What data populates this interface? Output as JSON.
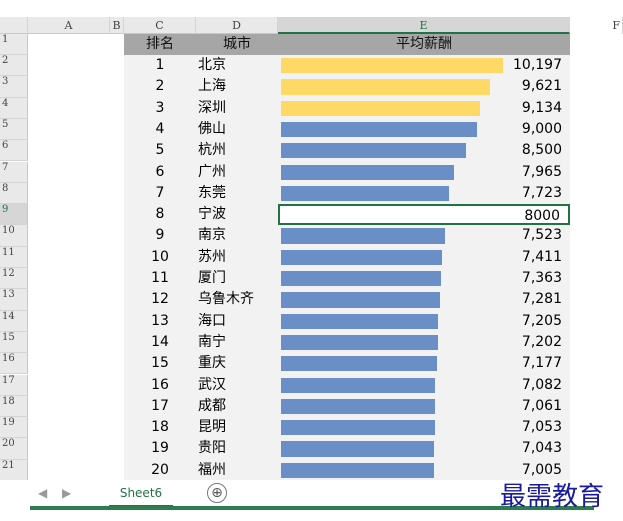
{
  "columns": [
    "A",
    "B",
    "C",
    "D",
    "E",
    "F"
  ],
  "headers": {
    "rank": "排名",
    "city": "城市",
    "salary": "平均薪酬"
  },
  "row_numbers": [
    "1",
    "2",
    "3",
    "4",
    "5",
    "6",
    "7",
    "8",
    "9",
    "10",
    "11",
    "12",
    "13",
    "14",
    "15",
    "16",
    "17",
    "18",
    "19",
    "20",
    "21"
  ],
  "rows": [
    {
      "rank": "1",
      "city": "北京",
      "value": "10,197",
      "amount": 10197,
      "color": "#ffd966"
    },
    {
      "rank": "2",
      "city": "上海",
      "value": "9,621",
      "amount": 9621,
      "color": "#ffd966"
    },
    {
      "rank": "3",
      "city": "深圳",
      "value": "9,134",
      "amount": 9134,
      "color": "#ffd966"
    },
    {
      "rank": "4",
      "city": "佛山",
      "value": "9,000",
      "amount": 9000,
      "color": "#6a8ec6"
    },
    {
      "rank": "5",
      "city": "杭州",
      "value": "8,500",
      "amount": 8500,
      "color": "#6a8ec6"
    },
    {
      "rank": "6",
      "city": "广州",
      "value": "7,965",
      "amount": 7965,
      "color": "#6a8ec6"
    },
    {
      "rank": "7",
      "city": "东莞",
      "value": "7,723",
      "amount": 7723,
      "color": "#6a8ec6"
    },
    {
      "rank": "8",
      "city": "宁波",
      "value": "8000",
      "amount": 0,
      "color": "#6a8ec6",
      "selected": true
    },
    {
      "rank": "9",
      "city": "南京",
      "value": "7,523",
      "amount": 7523,
      "color": "#6a8ec6"
    },
    {
      "rank": "10",
      "city": "苏州",
      "value": "7,411",
      "amount": 7411,
      "color": "#6a8ec6"
    },
    {
      "rank": "11",
      "city": "厦门",
      "value": "7,363",
      "amount": 7363,
      "color": "#6a8ec6"
    },
    {
      "rank": "12",
      "city": "乌鲁木齐",
      "value": "7,281",
      "amount": 7281,
      "color": "#6a8ec6"
    },
    {
      "rank": "13",
      "city": "海口",
      "value": "7,205",
      "amount": 7205,
      "color": "#6a8ec6"
    },
    {
      "rank": "14",
      "city": "南宁",
      "value": "7,202",
      "amount": 7202,
      "color": "#6a8ec6"
    },
    {
      "rank": "15",
      "city": "重庆",
      "value": "7,177",
      "amount": 7177,
      "color": "#6a8ec6"
    },
    {
      "rank": "16",
      "city": "武汉",
      "value": "7,082",
      "amount": 7082,
      "color": "#6a8ec6"
    },
    {
      "rank": "17",
      "city": "成都",
      "value": "7,061",
      "amount": 7061,
      "color": "#6a8ec6"
    },
    {
      "rank": "18",
      "city": "昆明",
      "value": "7,053",
      "amount": 7053,
      "color": "#6a8ec6"
    },
    {
      "rank": "19",
      "city": "贵阳",
      "value": "7,043",
      "amount": 7043,
      "color": "#6a8ec6"
    },
    {
      "rank": "20",
      "city": "福州",
      "value": "7,005",
      "amount": 7005,
      "color": "#6a8ec6"
    }
  ],
  "bar_max": 10197,
  "sheet_tab": "Sheet6",
  "add_sheet": "⊕",
  "nav_prev": "◀",
  "nav_next": "▶",
  "watermark": "最需教育",
  "colors": {
    "highlight": "#ffd966",
    "bar": "#6a8ec6",
    "header": "#a6a6a6",
    "selection": "#217346"
  }
}
